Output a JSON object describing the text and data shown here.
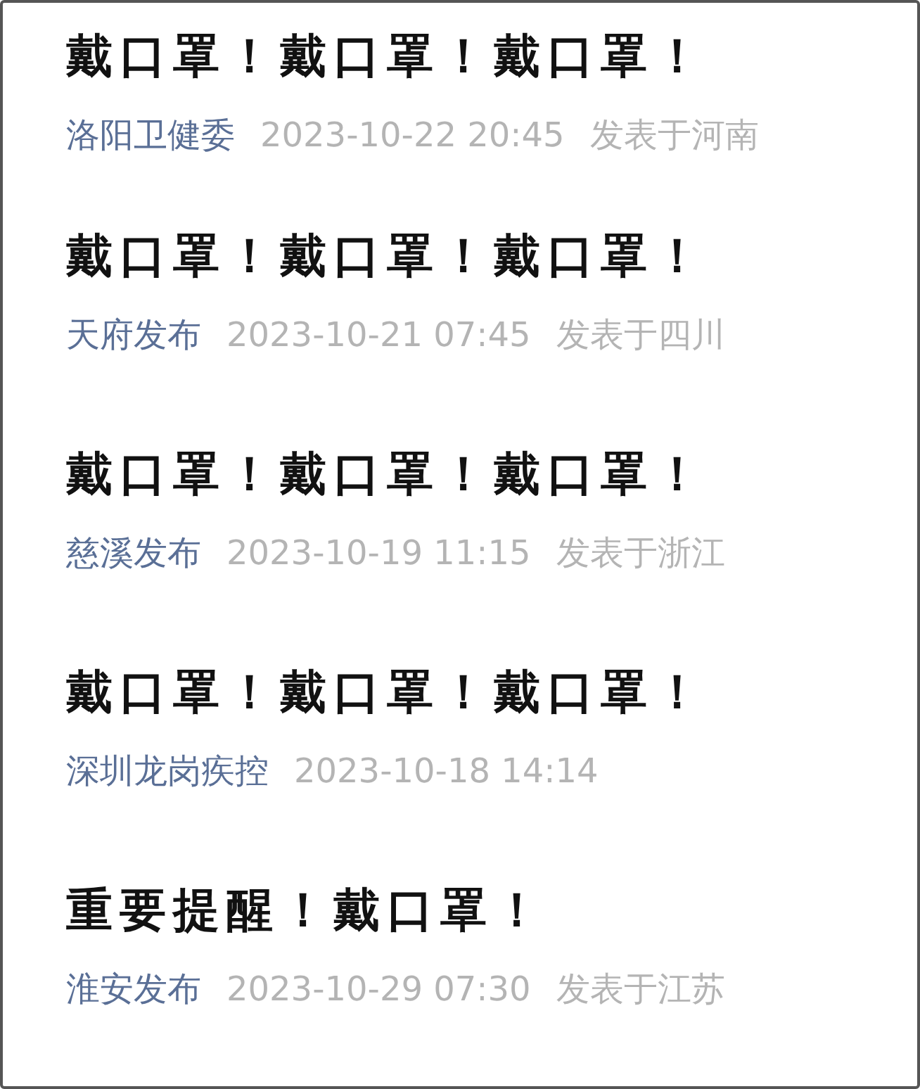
{
  "articles": [
    {
      "title": "戴口罩！戴口罩！戴口罩！",
      "source": "洛阳卫健委",
      "time": "2023-10-22 20:45",
      "location": "发表于河南"
    },
    {
      "title": "戴口罩！戴口罩！戴口罩！",
      "source": "天府发布",
      "time": "2023-10-21 07:45",
      "location": "发表于四川"
    },
    {
      "title": "戴口罩！戴口罩！戴口罩！",
      "source": "慈溪发布",
      "time": "2023-10-19 11:15",
      "location": "发表于浙江"
    },
    {
      "title": "戴口罩！戴口罩！戴口罩！",
      "source": "深圳龙岗疾控",
      "time": "2023-10-18 14:14"
    },
    {
      "title": "重要提醒！戴口罩！",
      "source": "淮安发布",
      "time": "2023-10-29 07:30",
      "location": "发表于江苏"
    }
  ]
}
